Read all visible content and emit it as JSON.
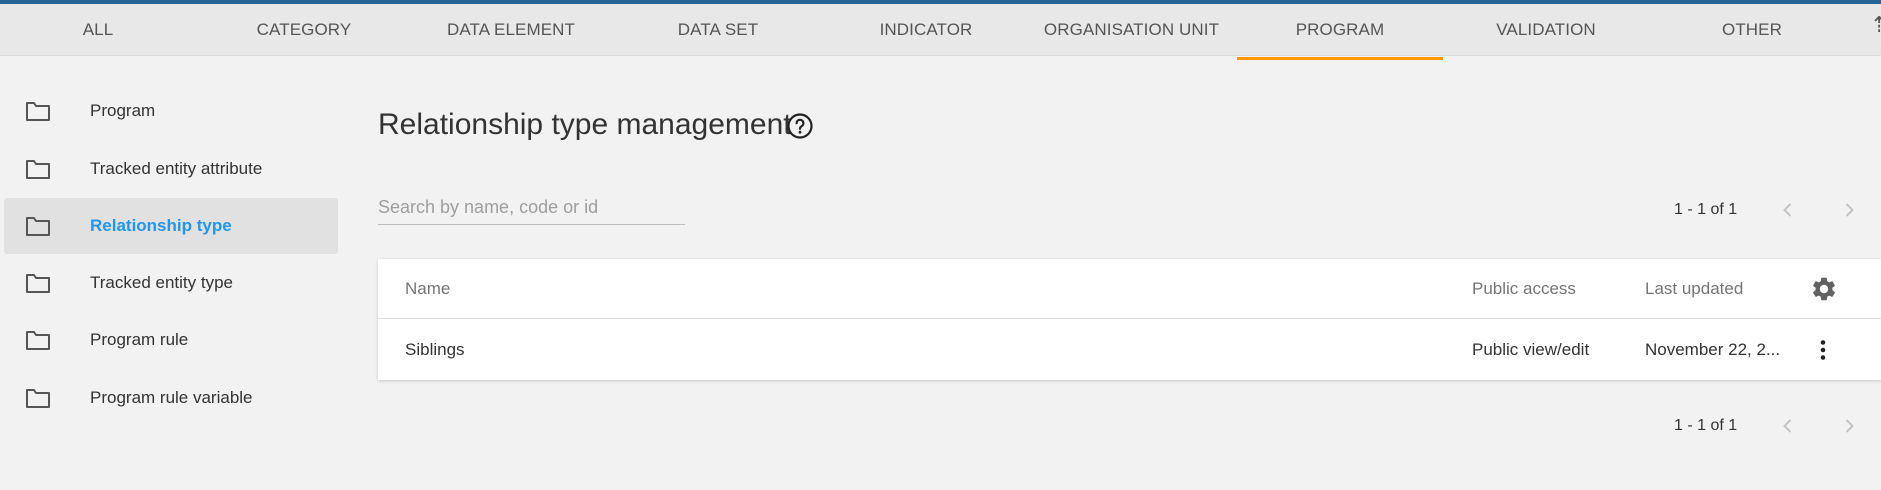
{
  "tabs": [
    {
      "label": "ALL"
    },
    {
      "label": "CATEGORY"
    },
    {
      "label": "DATA ELEMENT"
    },
    {
      "label": "DATA SET"
    },
    {
      "label": "INDICATOR"
    },
    {
      "label": "ORGANISATION UNIT"
    },
    {
      "label": "PROGRAM",
      "active": true
    },
    {
      "label": "VALIDATION"
    },
    {
      "label": "OTHER"
    }
  ],
  "sidebar": {
    "items": [
      {
        "label": "Program",
        "icon": "folder-icon"
      },
      {
        "label": "Tracked entity attribute",
        "icon": "folder-icon"
      },
      {
        "label": "Relationship type",
        "icon": "folder-icon",
        "active": true
      },
      {
        "label": "Tracked entity type",
        "icon": "folder-icon"
      },
      {
        "label": "Program rule",
        "icon": "folder-icon"
      },
      {
        "label": "Program rule variable",
        "icon": "folder-icon"
      }
    ]
  },
  "main": {
    "title": "Relationship type management",
    "help_icon": "help-circle-icon",
    "search_placeholder": "Search by name, code or id",
    "search_value": "",
    "pager_top": "1 - 1 of 1",
    "pager_bottom": "1 - 1 of 1"
  },
  "table": {
    "columns": [
      "Name",
      "Public access",
      "Last updated"
    ],
    "rows": [
      {
        "name": "Siblings",
        "public_access": "Public view/edit",
        "last_updated": "November 22, 2..."
      }
    ]
  },
  "colors": {
    "accent": "#ff9800",
    "active_link": "#2196f3",
    "header_bar": "#276696"
  }
}
